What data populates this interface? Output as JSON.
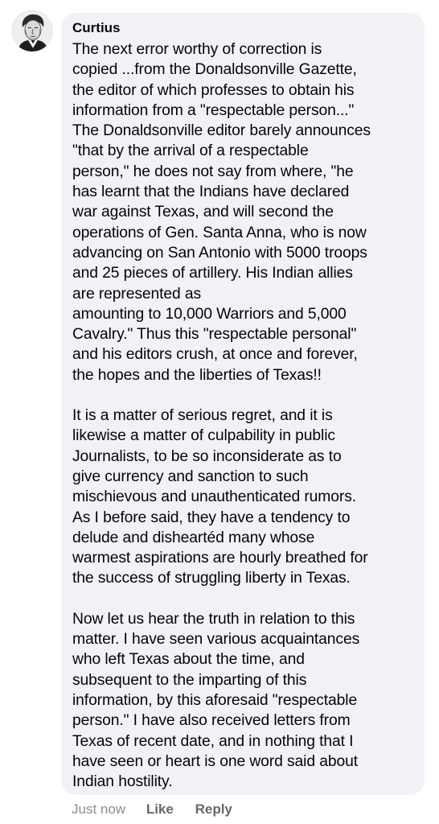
{
  "comment": {
    "author": "Curtius",
    "paragraphs": [
      {
        "lines": [
          "The next error worthy of correction is",
          "copied ...from the Donaldsonville Gazette,",
          "the editor of which professes to obtain his",
          "information from a \"respectable person...\"",
          "The Donaldsonville editor barely announces",
          "\"that by the arrival of a respectable",
          "person,\" he does not say from where, \"he",
          "has learnt that the Indians have declared",
          "war against Texas, and will second the",
          "operations of Gen. Santa Anna, who is now",
          "advancing on San Antonio with 5000 troops",
          "and 25 pieces of artillery. His Indian allies",
          "are represented as",
          "amounting to 10,000 Warriors and 5,000",
          "Cavalry.\" Thus this \"respectable personal\"",
          "and his editors crush, at once and forever,",
          "the hopes and the liberties of Texas!!"
        ]
      },
      {
        "lines": [
          "It is a matter of serious regret, and it is",
          "likewise a matter of culpability in public",
          "Journalists, to be so inconsiderate as to",
          "give currency and sanction to such",
          "mischievous and unauthenticated rumors.",
          "As I before said, they have a tendency to",
          "delude and disheartéd many whose",
          "warmest aspirations are hourly breathed for",
          "the success of struggling liberty in Texas."
        ]
      },
      {
        "lines": [
          "Now let us hear the truth in relation to this",
          "matter. I have seen various acquaintances",
          "who left Texas about the time, and",
          "subsequent to the imparting of this",
          "information, by this aforesaid \"respectable",
          "person.\" I have also received letters from",
          "Texas of recent date, and in nothing that I",
          "have seen or heart is one word said about",
          "Indian hostility."
        ]
      }
    ],
    "timestamp": "Just now",
    "like_label": "Like",
    "reply_label": "Reply"
  },
  "colors": {
    "bubble": "#f0f2f5",
    "text": "#050505",
    "meta": "#65676b"
  },
  "icons": {
    "avatar": "portrait-engraving-avatar"
  }
}
